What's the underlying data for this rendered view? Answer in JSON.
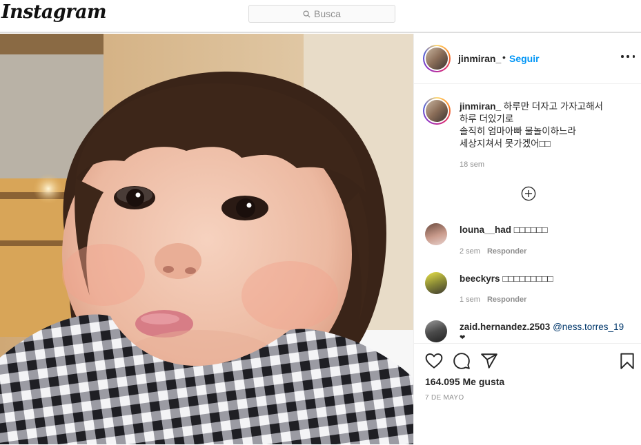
{
  "header": {
    "logo": "Instagram",
    "search_placeholder": "Busca"
  },
  "post": {
    "username": "jinmiran_",
    "separator": "•",
    "follow_label": "Seguir",
    "caption_user": "jinmiran_",
    "caption_lines": [
      "하루만 더자고 가자고해서",
      "하루 더있기로",
      "솔직히 엄마아빠 물놀이하느라",
      "세상지쳐서 못가겠어□□"
    ],
    "caption_time": "18 sem"
  },
  "comments": [
    {
      "username": "louna__had",
      "text": "□□□□□□",
      "time": "2 sem",
      "reply_label": "Responder"
    },
    {
      "username": "beeckyrs",
      "text": "□□□□□□□□□",
      "time": "1 sem",
      "reply_label": "Responder"
    },
    {
      "username": "zaid.hernandez.2503",
      "mention": "@ness.torres_19",
      "continuation": "❤"
    }
  ],
  "footer": {
    "likes": "164.095 Me gusta",
    "date": "7 DE MAYO"
  },
  "icons": [
    "search-icon",
    "more-icon",
    "add-comment-icon",
    "heart-icon",
    "comment-icon",
    "share-icon",
    "bookmark-icon"
  ],
  "colors": {
    "link": "#0095f6",
    "mention": "#00376b",
    "muted": "#8e8e8e",
    "border": "#dbdbdb"
  }
}
